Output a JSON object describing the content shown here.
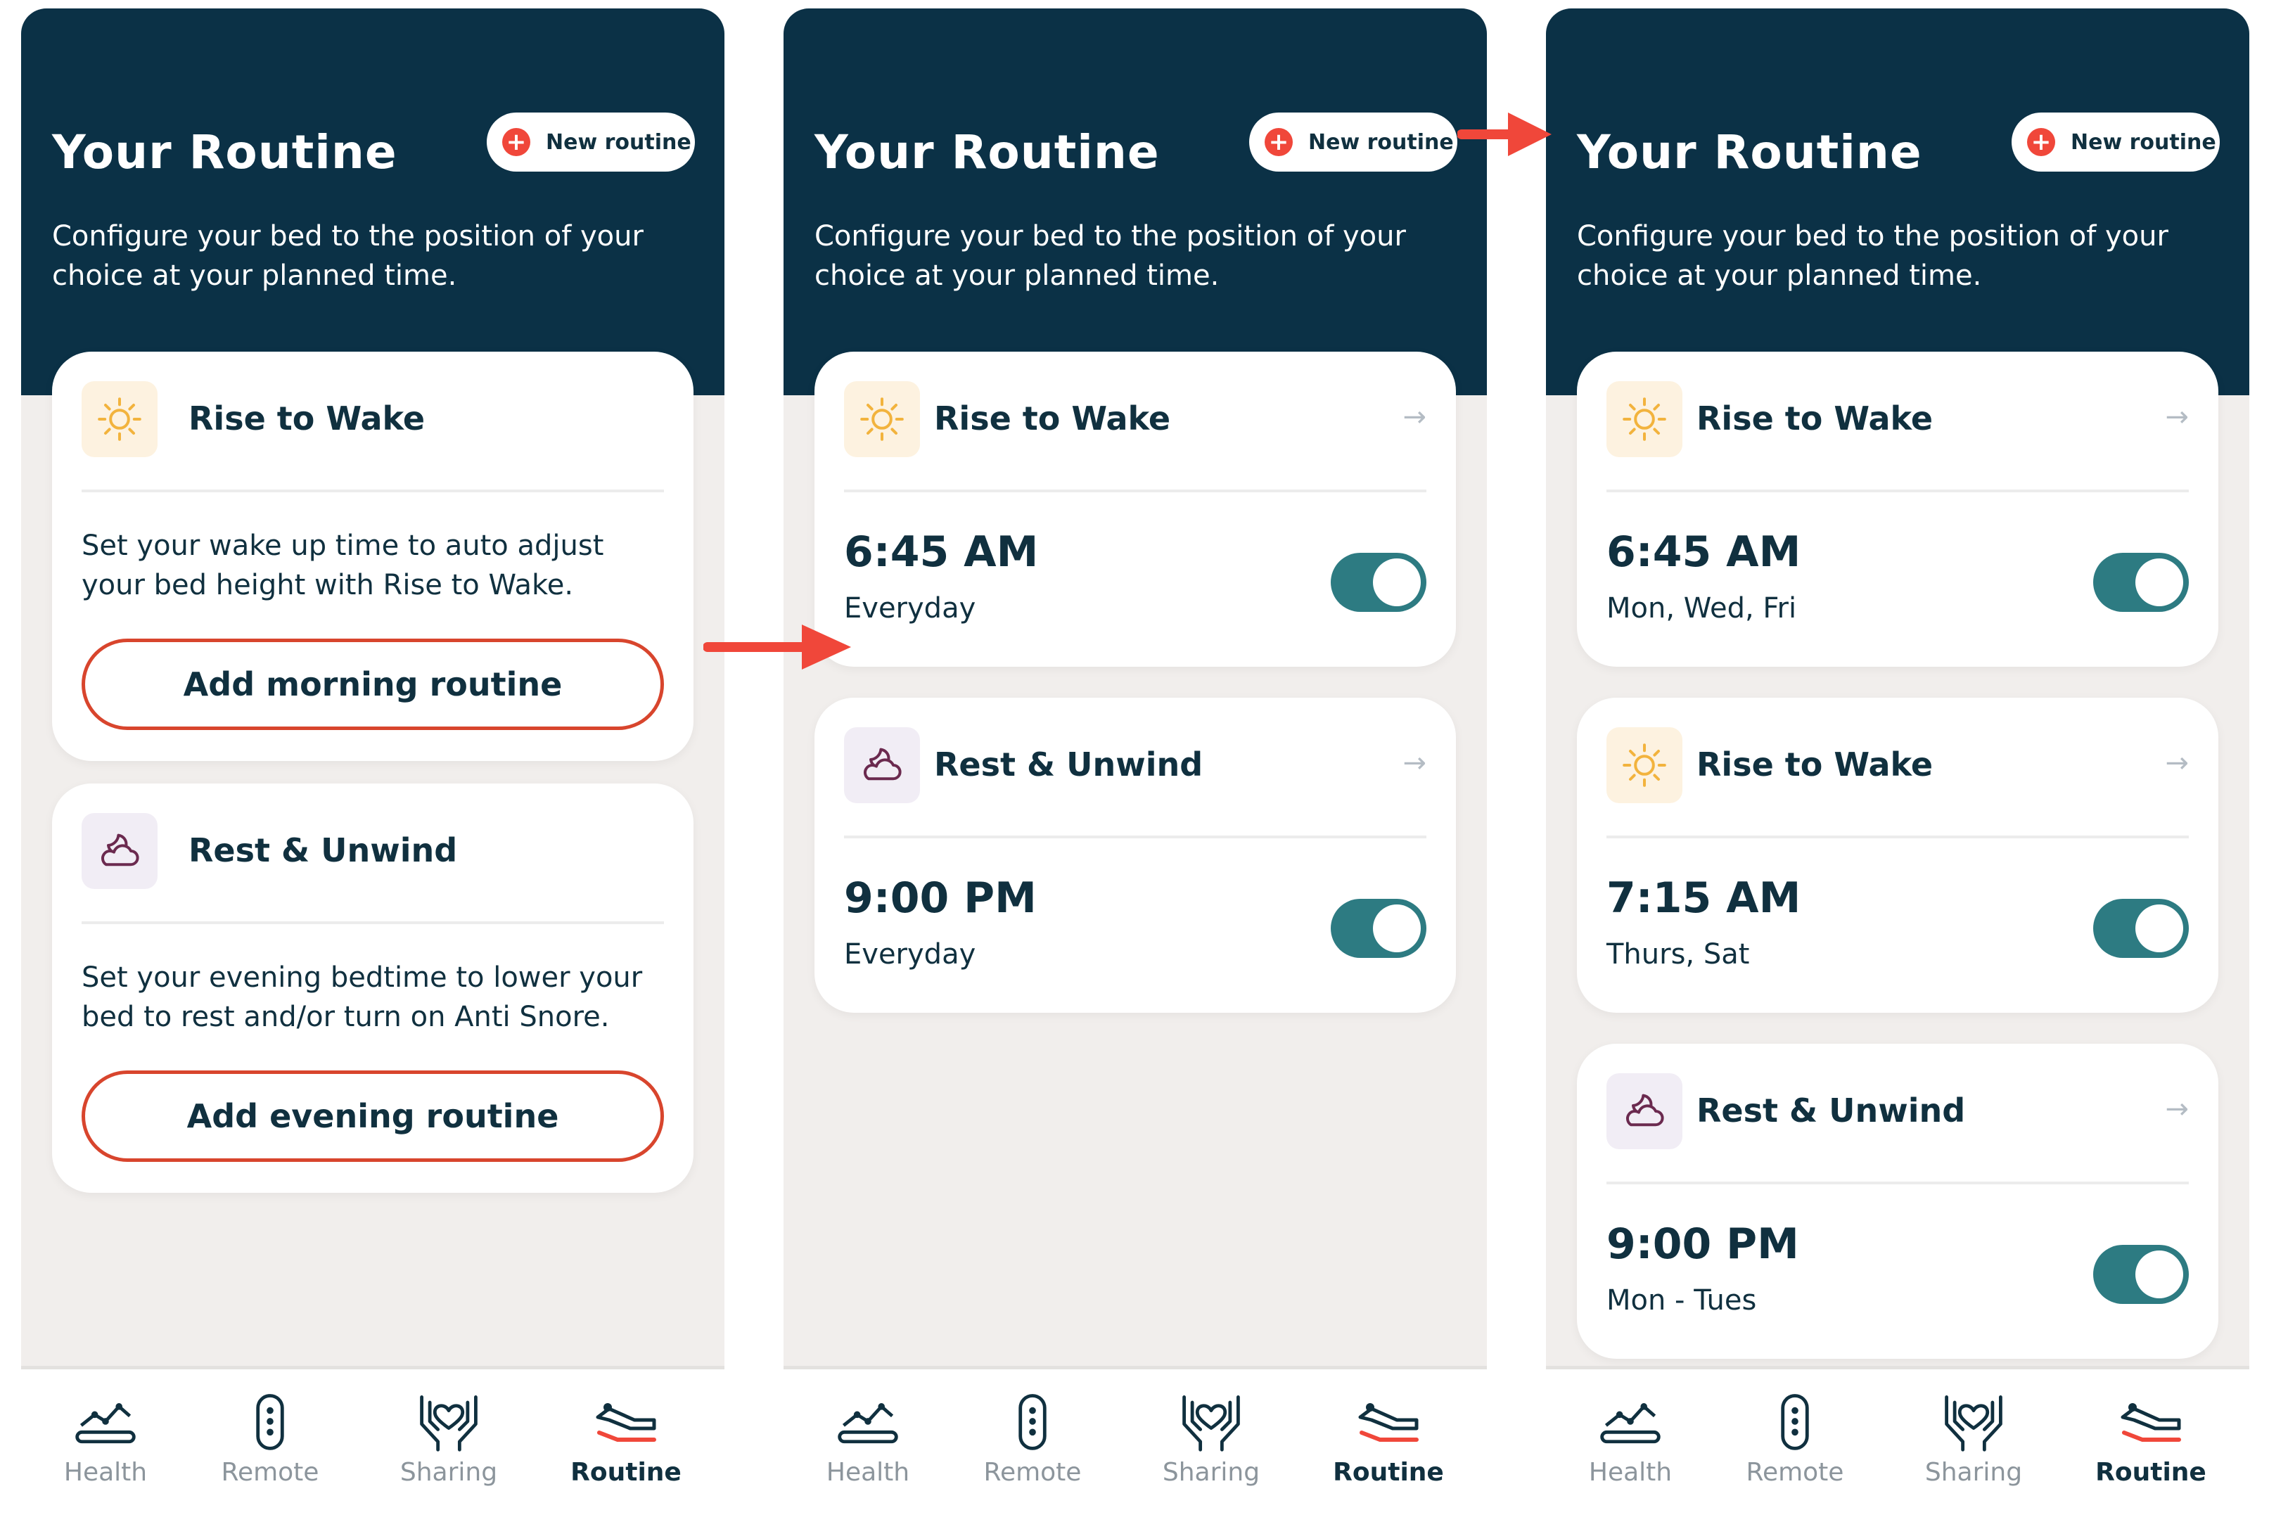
{
  "screens": [
    {
      "header": {
        "title": "Your Routine",
        "new_routine_label": "New routine",
        "description": "Configure your bed to the position of your choice at your planned time."
      },
      "cards": [
        {
          "title": "Rise to Wake",
          "body": "Set your wake up time to auto adjust your bed height with Rise to Wake.",
          "button": "Add morning routine"
        },
        {
          "title": "Rest & Unwind",
          "body": "Set your evening bedtime to lower your bed to rest and/or turn on Anti Snore.",
          "button": "Add evening routine"
        }
      ]
    },
    {
      "header": {
        "title": "Your Routine",
        "new_routine_label": "New routine",
        "description": "Configure your bed to the position of your choice at your planned time."
      },
      "cards": [
        {
          "title": "Rise to Wake",
          "time": "6:45 AM",
          "days": "Everyday",
          "enabled": true
        },
        {
          "title": "Rest & Unwind",
          "time": "9:00 PM",
          "days": "Everyday",
          "enabled": true
        }
      ]
    },
    {
      "header": {
        "title": "Your Routine",
        "new_routine_label": "New routine",
        "description": "Configure your bed to the position of your choice at your planned time."
      },
      "cards": [
        {
          "title": "Rise to Wake",
          "time": "6:45 AM",
          "days": "Mon, Wed, Fri",
          "enabled": true
        },
        {
          "title": "Rise to Wake",
          "time": "7:15 AM",
          "days": "Thurs, Sat",
          "enabled": true
        },
        {
          "title": "Rest & Unwind",
          "time": "9:00 PM",
          "days": "Mon - Tues",
          "enabled": true
        }
      ]
    }
  ],
  "tabbar": {
    "tabs": [
      {
        "label": "Health",
        "icon": "health-chart-icon"
      },
      {
        "label": "Remote",
        "icon": "remote-icon"
      },
      {
        "label": "Sharing",
        "icon": "hands-heart-icon"
      },
      {
        "label": "Routine",
        "icon": "bed-routine-icon"
      }
    ],
    "active": "Routine"
  },
  "colors": {
    "header": "#0b3146",
    "accent": "#f0473a",
    "toggle_on": "#2d7b82",
    "background": "#f1eeec",
    "button_border": "#d8452d"
  }
}
